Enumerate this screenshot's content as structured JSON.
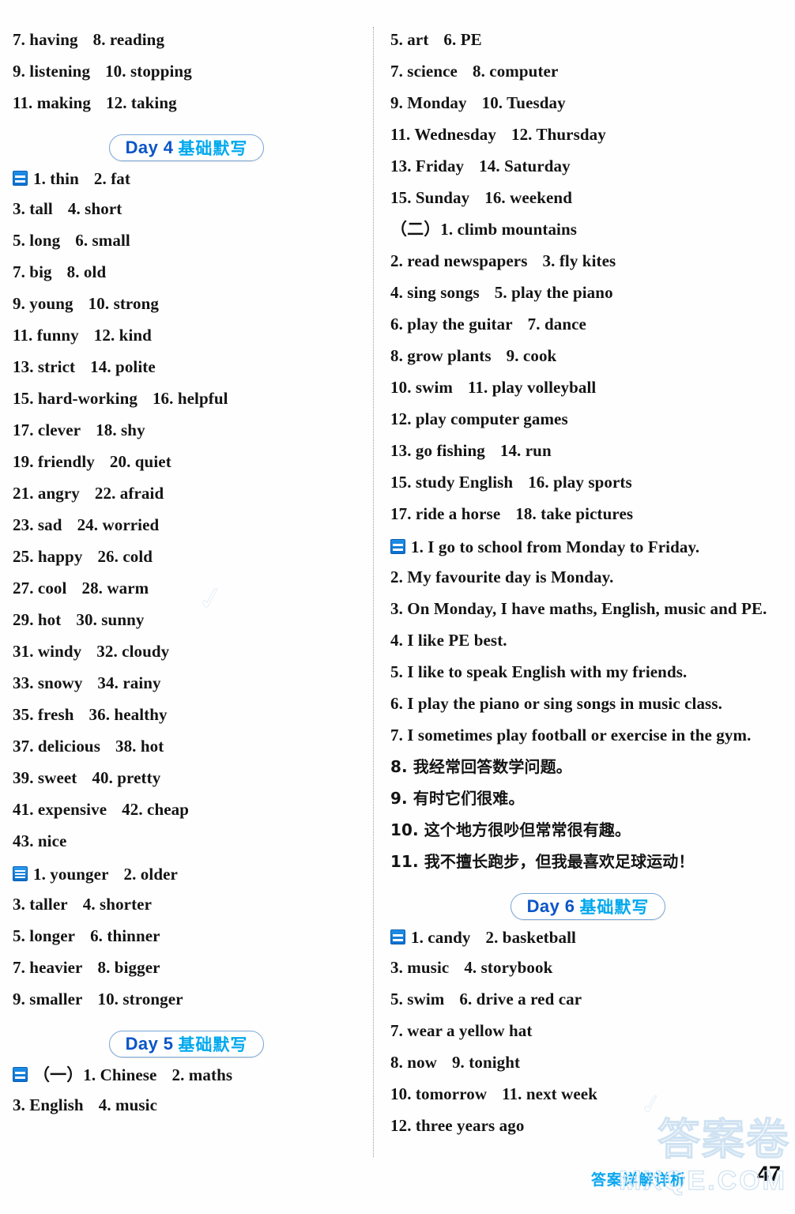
{
  "page": {
    "number": "47",
    "footer_brand": "答案详解详析",
    "watermark_cn": "答案卷",
    "watermark_en": "MXQE.COM",
    "watermark_ghost_1": "✓",
    "watermark_ghost_2": "✓"
  },
  "markers": {
    "eq": "two-bar-marker-icon",
    "bars3": "three-bar-marker-icon"
  },
  "day_label_cn": "基础默写",
  "left_column": [
    {
      "type": "line",
      "items": [
        "7. having",
        "8. reading"
      ]
    },
    {
      "type": "line",
      "items": [
        "9. listening",
        "10. stopping"
      ]
    },
    {
      "type": "line",
      "items": [
        "11. making",
        "12. taking"
      ]
    },
    {
      "type": "day",
      "label": "Day 4",
      "cn": "基础默写"
    },
    {
      "type": "line",
      "marker": "eq",
      "items": [
        "1. thin",
        "2. fat"
      ]
    },
    {
      "type": "line",
      "items": [
        "3. tall",
        "4. short"
      ]
    },
    {
      "type": "line",
      "items": [
        "5. long",
        "6. small"
      ]
    },
    {
      "type": "line",
      "items": [
        "7. big",
        "8. old"
      ]
    },
    {
      "type": "line",
      "items": [
        "9. young",
        "10. strong"
      ]
    },
    {
      "type": "line",
      "items": [
        "11. funny",
        "12. kind"
      ]
    },
    {
      "type": "line",
      "items": [
        "13. strict",
        "14. polite"
      ]
    },
    {
      "type": "line",
      "items": [
        "15. hard-working",
        "16. helpful"
      ]
    },
    {
      "type": "line",
      "items": [
        "17. clever",
        "18. shy"
      ]
    },
    {
      "type": "line",
      "items": [
        "19. friendly",
        "20. quiet"
      ]
    },
    {
      "type": "line",
      "items": [
        "21. angry",
        "22. afraid"
      ]
    },
    {
      "type": "line",
      "items": [
        "23. sad",
        "24. worried"
      ]
    },
    {
      "type": "line",
      "items": [
        "25. happy",
        "26. cold"
      ]
    },
    {
      "type": "line",
      "items": [
        "27. cool",
        "28. warm"
      ]
    },
    {
      "type": "line",
      "items": [
        "29. hot",
        "30. sunny"
      ]
    },
    {
      "type": "line",
      "items": [
        "31. windy",
        "32. cloudy"
      ]
    },
    {
      "type": "line",
      "items": [
        "33. snowy",
        "34. rainy"
      ]
    },
    {
      "type": "line",
      "items": [
        "35. fresh",
        "36. healthy"
      ]
    },
    {
      "type": "line",
      "items": [
        "37. delicious",
        "38. hot"
      ]
    },
    {
      "type": "line",
      "items": [
        "39. sweet",
        "40. pretty"
      ]
    },
    {
      "type": "line",
      "items": [
        "41. expensive",
        "42. cheap"
      ]
    },
    {
      "type": "line",
      "items": [
        "43. nice"
      ]
    },
    {
      "type": "line",
      "marker": "bars3",
      "items": [
        "1. younger",
        "2. older"
      ]
    },
    {
      "type": "line",
      "items": [
        "3. taller",
        "4. shorter"
      ]
    },
    {
      "type": "line",
      "items": [
        "5. longer",
        "6. thinner"
      ]
    },
    {
      "type": "line",
      "items": [
        "7. heavier",
        "8. bigger"
      ]
    },
    {
      "type": "line",
      "items": [
        "9. smaller",
        "10. stronger"
      ]
    },
    {
      "type": "day",
      "label": "Day 5",
      "cn": "基础默写"
    },
    {
      "type": "line",
      "marker": "eq",
      "items": [
        "（一）1. Chinese",
        "2. maths"
      ]
    },
    {
      "type": "line",
      "items": [
        "3. English",
        "4. music"
      ]
    }
  ],
  "right_column": [
    {
      "type": "line",
      "items": [
        "5. art",
        "6. PE"
      ]
    },
    {
      "type": "line",
      "items": [
        "7. science",
        "8. computer"
      ]
    },
    {
      "type": "line",
      "items": [
        "9. Monday",
        "10. Tuesday"
      ]
    },
    {
      "type": "line",
      "items": [
        "11. Wednesday",
        "12. Thursday"
      ]
    },
    {
      "type": "line",
      "items": [
        "13. Friday",
        "14. Saturday"
      ]
    },
    {
      "type": "line",
      "items": [
        "15. Sunday",
        "16. weekend"
      ]
    },
    {
      "type": "line",
      "items": [
        "（二）1. climb mountains"
      ]
    },
    {
      "type": "line",
      "items": [
        "2. read newspapers",
        "3. fly kites"
      ]
    },
    {
      "type": "line",
      "items": [
        "4. sing songs",
        "5. play the piano"
      ]
    },
    {
      "type": "line",
      "items": [
        "6. play the guitar",
        "7. dance"
      ]
    },
    {
      "type": "line",
      "items": [
        "8. grow plants",
        "9. cook"
      ]
    },
    {
      "type": "line",
      "items": [
        "10. swim",
        "11. play volleyball"
      ]
    },
    {
      "type": "line",
      "items": [
        "12. play computer games"
      ]
    },
    {
      "type": "line",
      "items": [
        "13. go fishing",
        "14. run"
      ]
    },
    {
      "type": "line",
      "items": [
        "15. study English",
        "16. play sports"
      ]
    },
    {
      "type": "line",
      "items": [
        "17. ride a horse",
        "18. take pictures"
      ]
    },
    {
      "type": "line",
      "marker": "eq",
      "items": [
        "1. I go to school from Monday to Friday."
      ]
    },
    {
      "type": "line",
      "items": [
        "2. My favourite day is Monday."
      ]
    },
    {
      "type": "line",
      "items": [
        "3. On Monday, I have maths, English, music and PE."
      ]
    },
    {
      "type": "line",
      "items": [
        "4. I like PE best."
      ]
    },
    {
      "type": "line",
      "items": [
        "5. I like to speak English with my friends."
      ]
    },
    {
      "type": "line",
      "items": [
        "6. I play the piano or sing songs in music class."
      ]
    },
    {
      "type": "line",
      "items": [
        "7. I sometimes play football or exercise in the gym."
      ]
    },
    {
      "type": "line",
      "cn": true,
      "items": [
        "8. 我经常回答数学问题。"
      ]
    },
    {
      "type": "line",
      "cn": true,
      "items": [
        "9. 有时它们很难。"
      ]
    },
    {
      "type": "line",
      "cn": true,
      "items": [
        "10. 这个地方很吵但常常很有趣。"
      ]
    },
    {
      "type": "line",
      "cn": true,
      "items": [
        "11. 我不擅长跑步，但我最喜欢足球运动！"
      ]
    },
    {
      "type": "day",
      "label": "Day 6",
      "cn": "基础默写"
    },
    {
      "type": "line",
      "marker": "eq",
      "items": [
        "1. candy",
        "2. basketball"
      ]
    },
    {
      "type": "line",
      "items": [
        "3. music",
        "4. storybook"
      ]
    },
    {
      "type": "line",
      "items": [
        "5. swim",
        "6. drive a red car"
      ]
    },
    {
      "type": "line",
      "items": [
        "7. wear a yellow hat"
      ]
    },
    {
      "type": "line",
      "items": [
        "8. now",
        "9. tonight"
      ]
    },
    {
      "type": "line",
      "items": [
        "10. tomorrow",
        "11. next week"
      ]
    },
    {
      "type": "line",
      "items": [
        "12. three years ago"
      ]
    }
  ]
}
